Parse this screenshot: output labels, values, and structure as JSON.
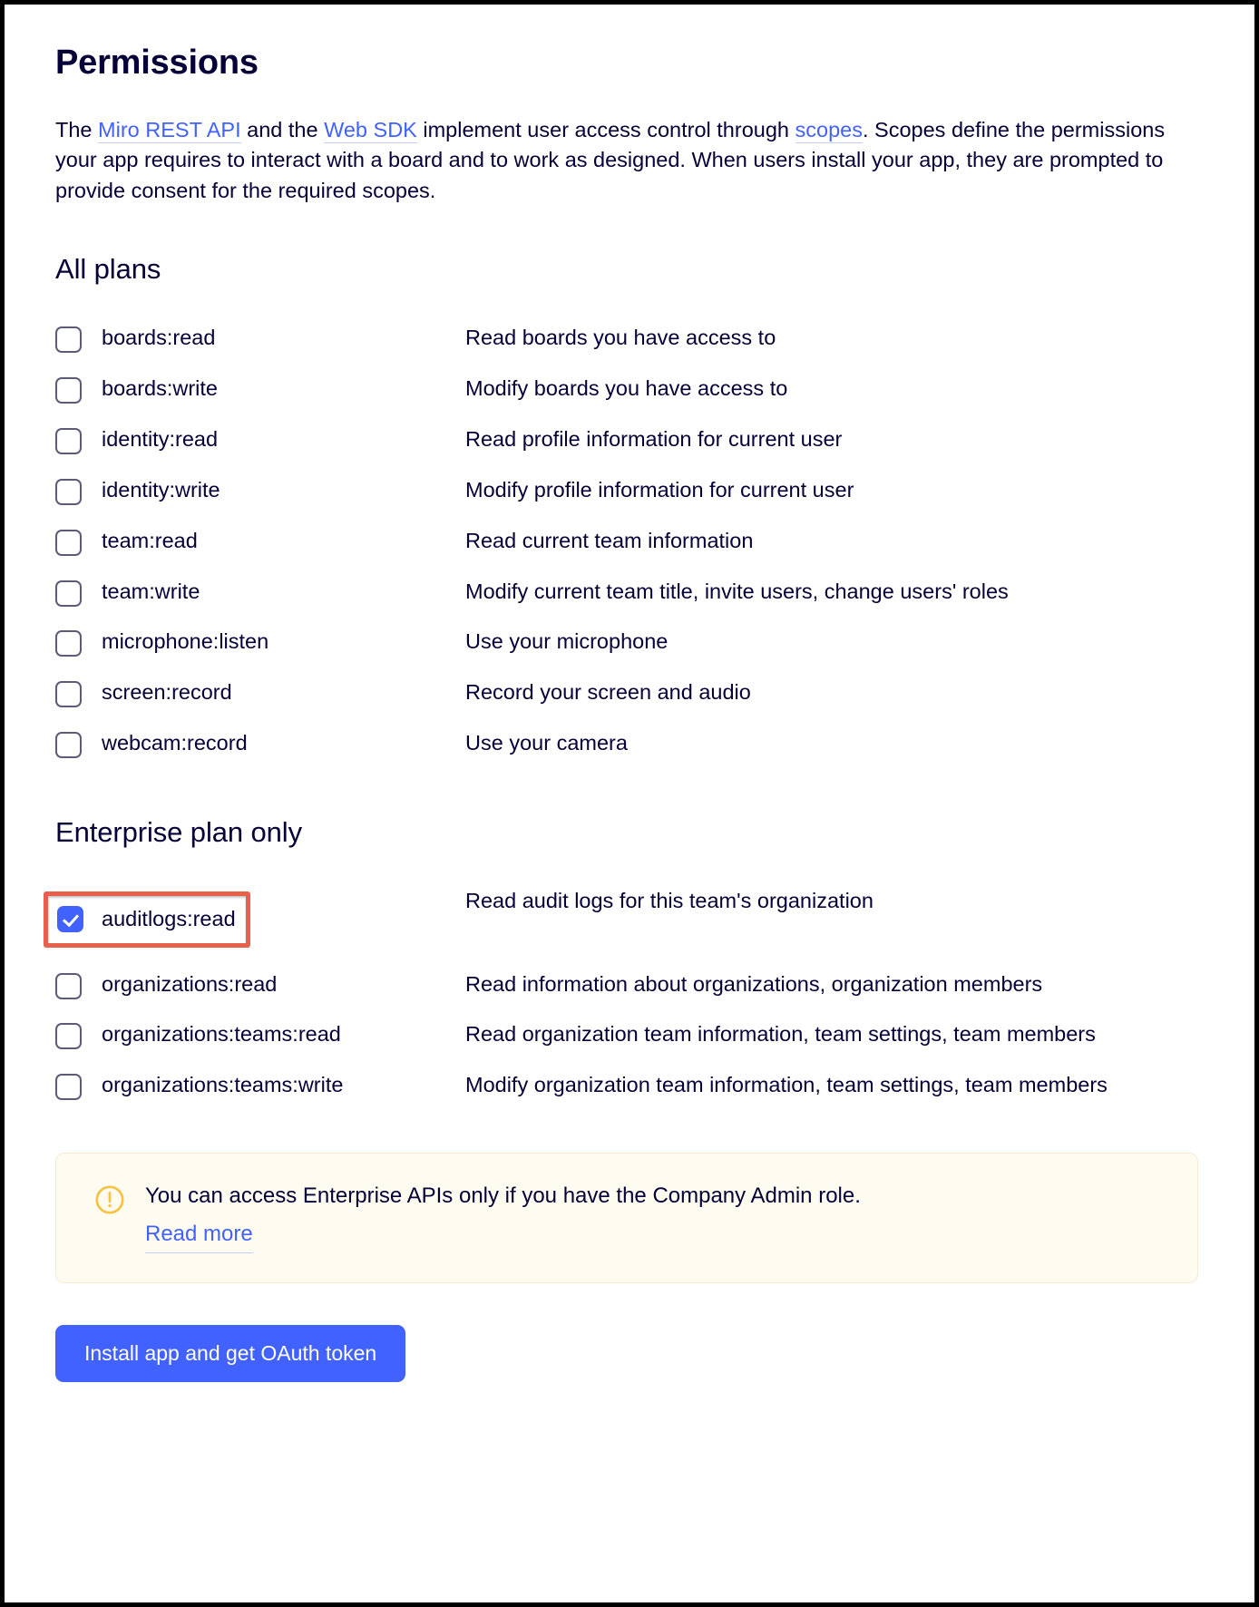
{
  "page": {
    "title": "Permissions",
    "intro": {
      "before_link1": "The ",
      "link1": "Miro REST API",
      "between_1_2": " and the ",
      "link2": "Web SDK",
      "between_2_3": " implement user access control through ",
      "link3": "scopes",
      "after_link3": ". Scopes define the permissions your app requires to interact with a board and to work as designed. When users install your app, they are prompted to provide consent for the required scopes."
    }
  },
  "sections": [
    {
      "heading": "All plans",
      "scopes": [
        {
          "name": "boards:read",
          "description": "Read boards you have access to",
          "checked": false
        },
        {
          "name": "boards:write",
          "description": "Modify boards you have access to",
          "checked": false
        },
        {
          "name": "identity:read",
          "description": "Read profile information for current user",
          "checked": false
        },
        {
          "name": "identity:write",
          "description": "Modify profile information for current user",
          "checked": false
        },
        {
          "name": "team:read",
          "description": "Read current team information",
          "checked": false
        },
        {
          "name": "team:write",
          "description": "Modify current team title, invite users, change users' roles",
          "checked": false
        },
        {
          "name": "microphone:listen",
          "description": "Use your microphone",
          "checked": false
        },
        {
          "name": "screen:record",
          "description": "Record your screen and audio",
          "checked": false
        },
        {
          "name": "webcam:record",
          "description": "Use your camera",
          "checked": false
        }
      ]
    },
    {
      "heading": "Enterprise plan only",
      "scopes": [
        {
          "name": "auditlogs:read",
          "description": "Read audit logs for this team's organization",
          "checked": true,
          "highlighted": true
        },
        {
          "name": "organizations:read",
          "description": "Read information about organizations, organization members",
          "checked": false
        },
        {
          "name": "organizations:teams:read",
          "description": "Read organization team information, team settings, team members",
          "checked": false
        },
        {
          "name": "organizations:teams:write",
          "description": "Modify organization team information, team settings, team members",
          "checked": false
        }
      ]
    }
  ],
  "callout": {
    "icon": "warning-circle-icon",
    "text": "You can access Enterprise APIs only if you have the Company Admin role.",
    "link_label": "Read more"
  },
  "actions": {
    "install_button_label": "Install app and get OAuth token"
  },
  "colors": {
    "accent_blue": "#4262ff",
    "highlight_red": "#e8604c",
    "text_navy": "#050038",
    "callout_bg": "#fefbf0",
    "warning_yellow": "#f5c242"
  }
}
